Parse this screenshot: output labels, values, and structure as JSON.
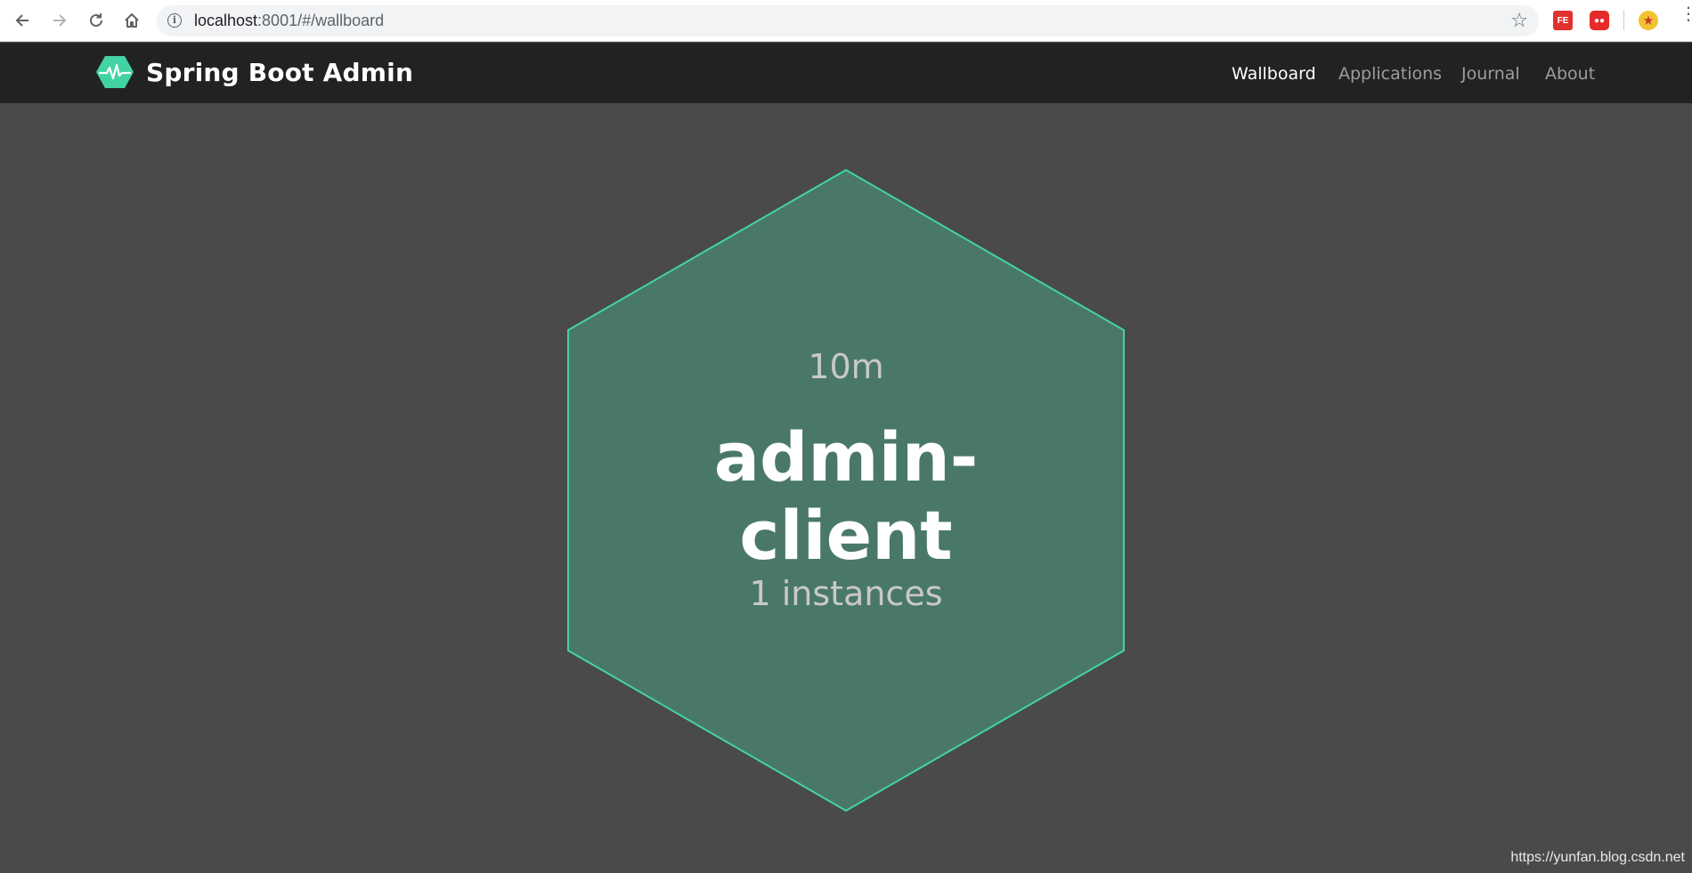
{
  "browser": {
    "url_host": "localhost",
    "url_rest": ":8001/#/wallboard",
    "icons": {
      "back": "arrow-left-icon",
      "forward": "arrow-right-icon",
      "reload": "reload-icon",
      "home": "home-icon",
      "info": "info-icon",
      "star": "star-icon"
    },
    "extensions": [
      {
        "name": "fe-helper-extension",
        "label": "FE"
      },
      {
        "name": "red-extension",
        "label": ""
      },
      {
        "name": "avatar-extension",
        "label": ""
      }
    ]
  },
  "navbar": {
    "brand": "Spring Boot Admin",
    "links": [
      {
        "label": "Wallboard",
        "active": true
      },
      {
        "label": "Applications",
        "active": false
      },
      {
        "label": "Journal",
        "active": false
      },
      {
        "label": "About",
        "active": false
      }
    ]
  },
  "wallboard": {
    "application": {
      "uptime": "10m",
      "name": "admin-\nclient",
      "instances": "1 instances",
      "status_color": "#42d3a5"
    }
  },
  "watermark": "https://yunfan.blog.csdn.net",
  "colors": {
    "background": "#4a4a4a",
    "navbar": "#222222",
    "accent": "#42d3a5",
    "hex_fill": "#4a7867"
  }
}
